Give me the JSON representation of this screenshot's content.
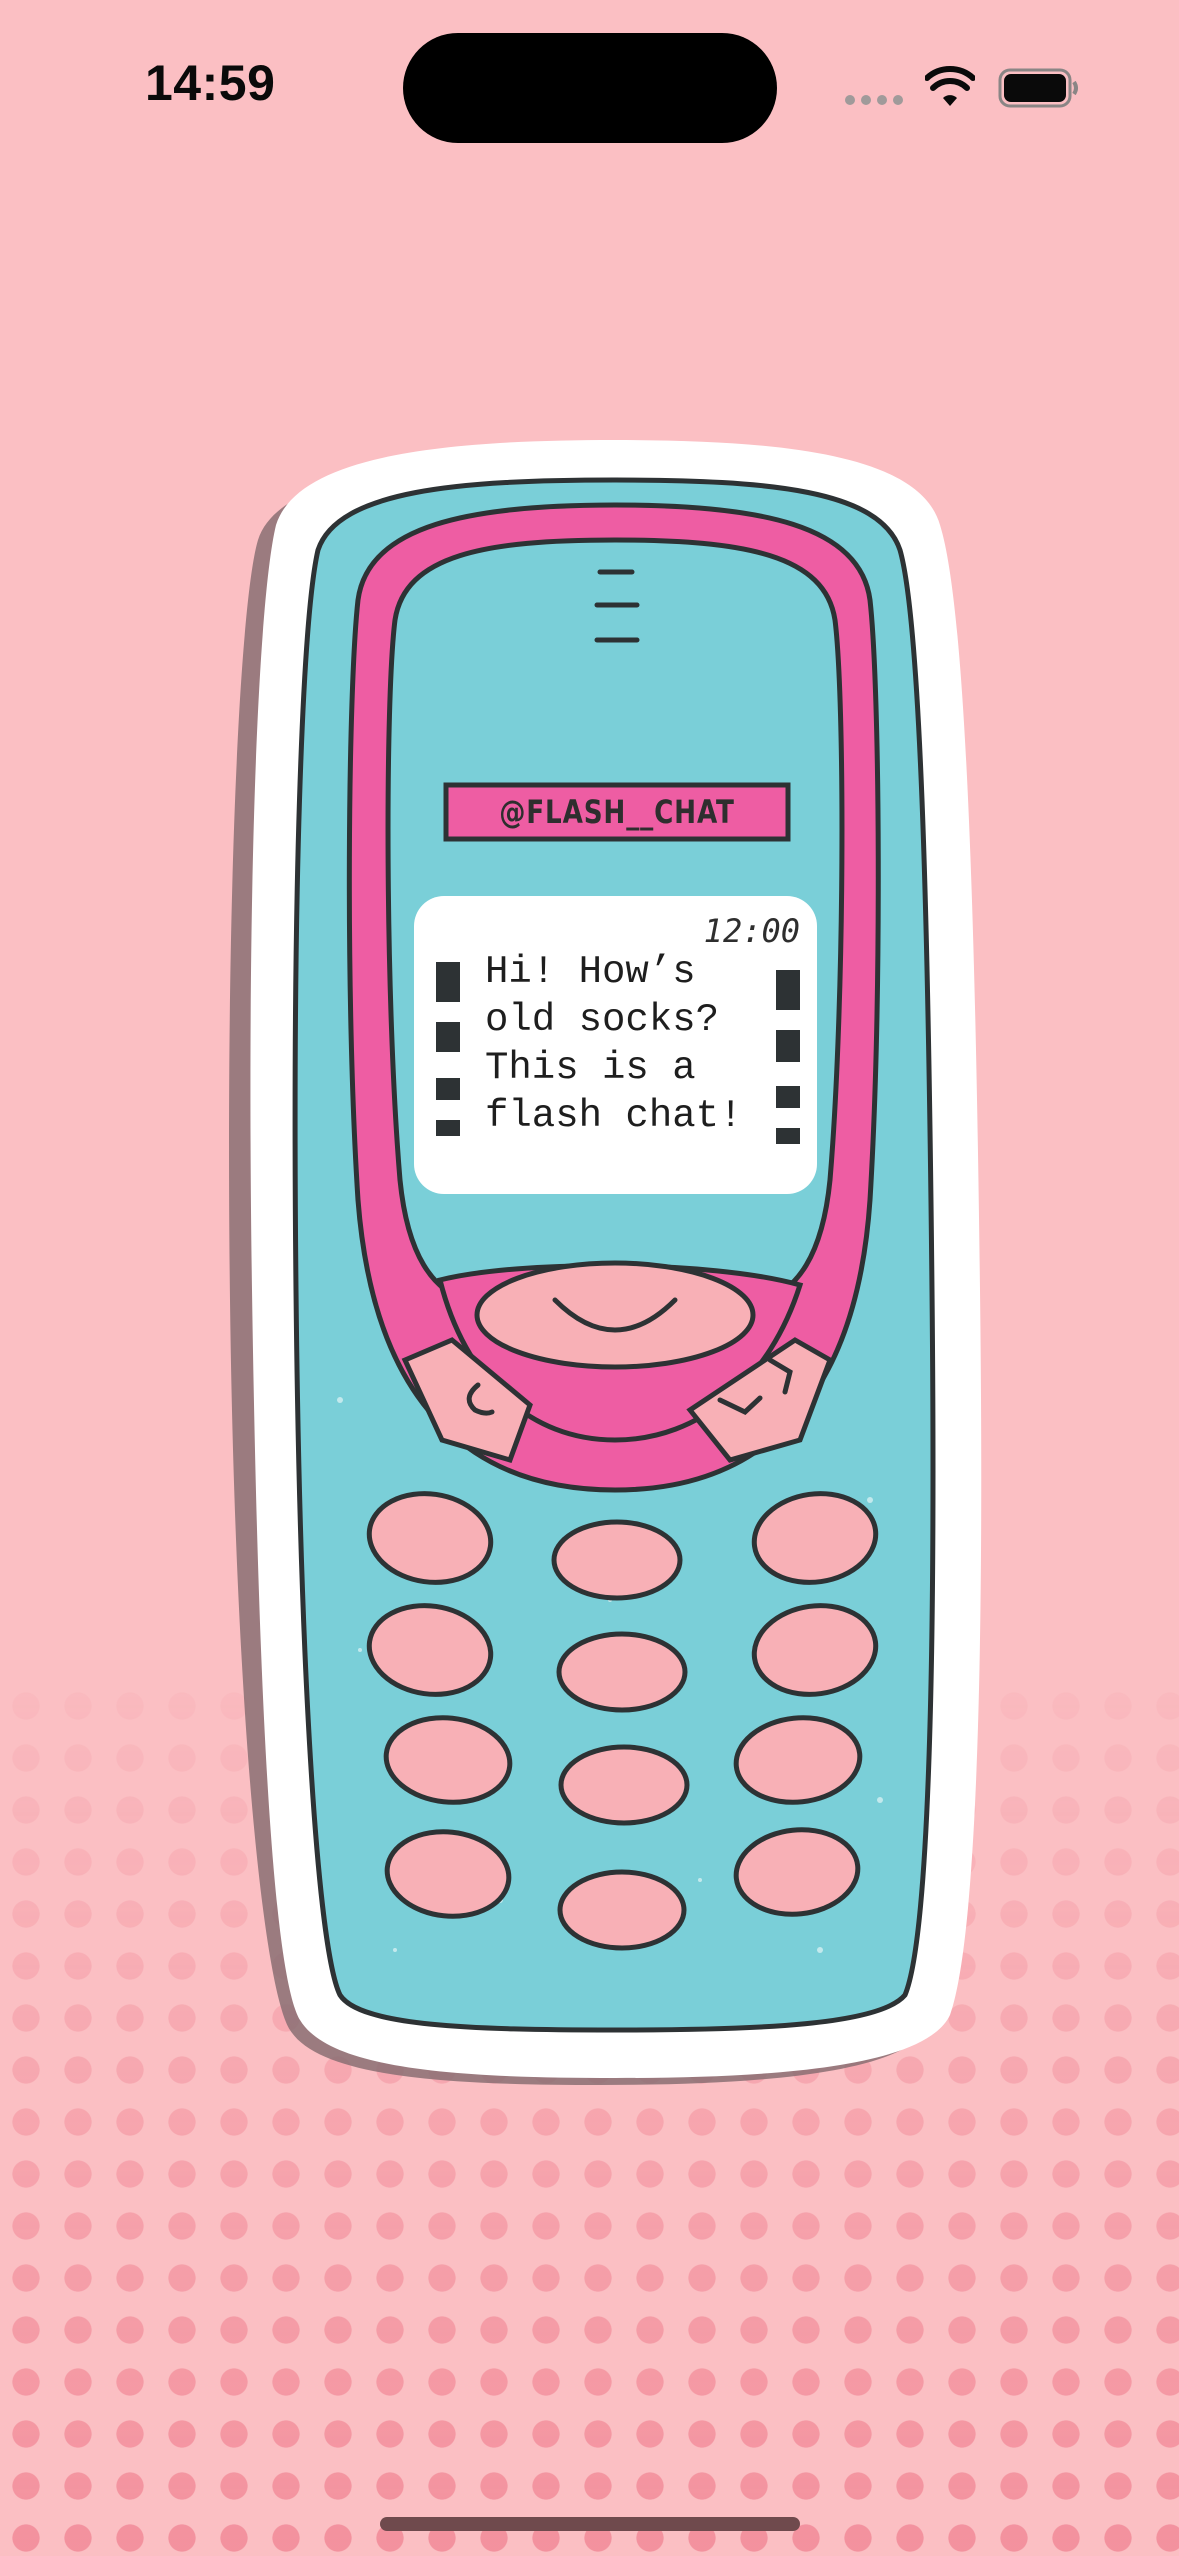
{
  "status_bar": {
    "time": "14:59",
    "icons": [
      "signal-dots-icon",
      "wifi-icon",
      "battery-icon"
    ]
  },
  "phone_sticker": {
    "handle": "@FLASH__CHAT",
    "screen_time": "12:00",
    "message_lines": [
      "Hi! How’s",
      "old socks?",
      "This is a",
      "flash chat!"
    ],
    "soft_keys": {
      "left": "C",
      "right": "^v"
    }
  },
  "colors": {
    "background": "#fbbfc3",
    "phone_body": "#7acfd8",
    "phone_trim": "#ee5da3",
    "keys": "#f8b0b6",
    "outline": "#2d3234",
    "screen": "#ffffff"
  }
}
